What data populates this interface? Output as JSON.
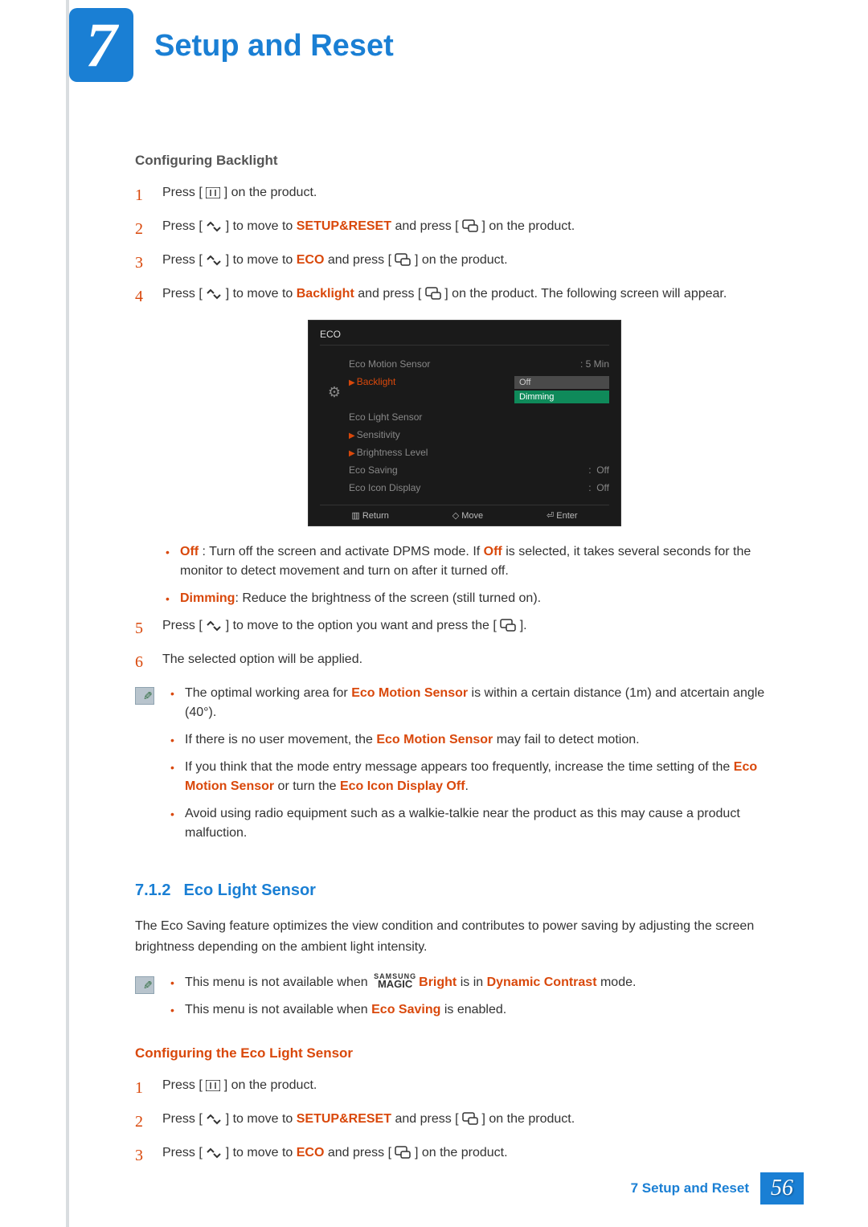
{
  "chapter": {
    "number": "7",
    "title": "Setup and Reset"
  },
  "section1": {
    "heading": "Configuring Backlight",
    "steps": [
      {
        "n": "1",
        "pre": "Press [",
        "post": "] on the product."
      },
      {
        "n": "2",
        "pre": "Press [",
        "mid": "] to move to ",
        "kw": "SETUP&RESET",
        "post1": " and press [",
        "post2": "] on the product."
      },
      {
        "n": "3",
        "pre": "Press [",
        "mid": "] to move to ",
        "kw": "ECO",
        "post1": " and press [",
        "post2": "] on the product."
      },
      {
        "n": "4",
        "pre": "Press [",
        "mid": "] to move to ",
        "kw": "Backlight",
        "post1": " and press [",
        "post2": "] on the product. The following screen will appear."
      }
    ],
    "bullets_after_osd": [
      {
        "kw": "Off",
        "sep": " : ",
        "text": "Turn off the screen and activate DPMS mode. If ",
        "kw2": "Off",
        "text2": " is selected, it takes several seconds for the monitor to detect movement and turn on after it turned off."
      },
      {
        "kw": "Dimming",
        "sep": ": ",
        "text": "Reduce the brightness of the screen (still turned on)."
      }
    ],
    "step5": {
      "n": "5",
      "pre": "Press [",
      "mid": "] to move to the option you want and press the [",
      "post": "]."
    },
    "step6": {
      "n": "6",
      "text": "The selected option will be applied."
    },
    "notes": [
      {
        "pre": "The optimal working area for ",
        "kw": "Eco Motion Sensor",
        "post": " is within a certain distance (1m) and atcertain angle (40°)."
      },
      {
        "pre": "If there is no user movement, the ",
        "kw": "Eco Motion Sensor",
        "post": " may fail to detect motion."
      },
      {
        "pre": "If you think that the mode entry message appears too frequently, increase the time setting of the ",
        "kw": "Eco Motion Sensor",
        "mid": " or turn the ",
        "kw2": "Eco Icon Display Off",
        "post": "."
      },
      {
        "pre": "Avoid using radio equipment such as a walkie-talkie near the product as this may cause a product malfuction."
      }
    ]
  },
  "osd": {
    "title": "ECO",
    "items": [
      {
        "label": "Eco Motion Sensor",
        "value": "5 Min"
      },
      {
        "label": "Backlight",
        "selected": true,
        "dropdown": [
          "Off",
          "Dimming"
        ]
      },
      {
        "label": "Eco Light Sensor"
      },
      {
        "label": "Sensitivity",
        "arrow": true
      },
      {
        "label": "Brightness Level",
        "arrow": true
      },
      {
        "label": "Eco Saving",
        "value": "Off"
      },
      {
        "label": "Eco Icon Display",
        "value": "Off"
      }
    ],
    "footer": {
      "return": "Return",
      "move": "Move",
      "enter": "Enter"
    }
  },
  "section2": {
    "num": "7.1.2",
    "title": "Eco Light Sensor",
    "intro": "The Eco Saving feature optimizes the view condition and contributes to power saving by adjusting the screen brightness depending on the ambient light intensity.",
    "notes": [
      {
        "pre": "This menu is not available when ",
        "magic": true,
        "kw": "Bright",
        "mid": " is in ",
        "kw2": "Dynamic Contrast",
        "post": " mode."
      },
      {
        "pre": "This menu is not available when ",
        "kw": "Eco Saving",
        "post": " is enabled."
      }
    ],
    "subhead": "Configuring the Eco Light Sensor",
    "steps": [
      {
        "n": "1",
        "pre": "Press [",
        "post": "] on the product."
      },
      {
        "n": "2",
        "pre": "Press [",
        "mid": "] to move to ",
        "kw": "SETUP&RESET",
        "post1": " and press [",
        "post2": "] on the product."
      },
      {
        "n": "3",
        "pre": "Press [",
        "mid": "] to move to ",
        "kw": "ECO",
        "post1": " and press [",
        "post2": "] on the product."
      }
    ]
  },
  "footer": {
    "chapter": "7",
    "title": "Setup and Reset",
    "page": "56"
  }
}
